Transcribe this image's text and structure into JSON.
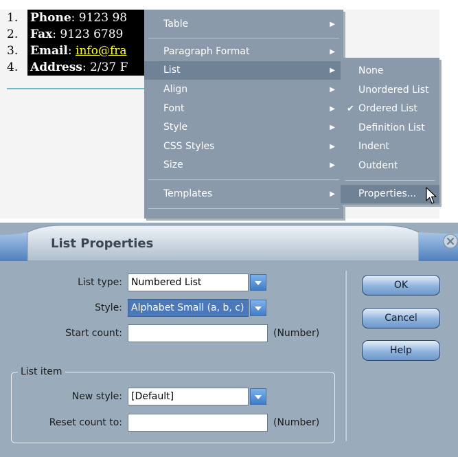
{
  "document": {
    "items": [
      {
        "num": "1.",
        "bold": "Phone",
        "rest": ": 9123 98",
        "link": ""
      },
      {
        "num": "2.",
        "bold": "Fax",
        "rest": ": 9123 6789",
        "link": ""
      },
      {
        "num": "3.",
        "bold": "Email",
        "rest": ": ",
        "link": "info@fra"
      },
      {
        "num": "4.",
        "bold": "Address",
        "rest": ": 2/37 F",
        "link": ""
      }
    ]
  },
  "context_menu": {
    "table": "Table",
    "paragraph_format": "Paragraph Format",
    "list": "List",
    "align": "Align",
    "font": "Font",
    "style": "Style",
    "css_styles": "CSS Styles",
    "size": "Size",
    "templates": "Templates"
  },
  "list_submenu": {
    "none": "None",
    "unordered_list": "Unordered List",
    "ordered_list": "Ordered List",
    "definition_list": "Definition List",
    "indent": "Indent",
    "outdent": "Outdent",
    "properties": "Properties..."
  },
  "dialog": {
    "title": "List Properties",
    "list_type_label": "List type:",
    "list_type_value": "Numbered List",
    "style_label": "Style:",
    "style_value": "Alphabet Small (a, b, c)",
    "start_count_label": "Start count:",
    "start_count_value": "",
    "number_hint_1": "(Number)",
    "list_item_legend": "List item",
    "new_style_label": "New style:",
    "new_style_value": "[Default]",
    "reset_count_label": "Reset count to:",
    "reset_count_value": "",
    "number_hint_2": "(Number)",
    "ok_label": "OK",
    "cancel_label": "Cancel",
    "help_label": "Help"
  },
  "colors": {
    "menu_bg": "#8a9aaa",
    "menu_highlight": "#6f8296",
    "dialog_bg": "#9aacbc",
    "link_yellow": "#ffff33"
  }
}
